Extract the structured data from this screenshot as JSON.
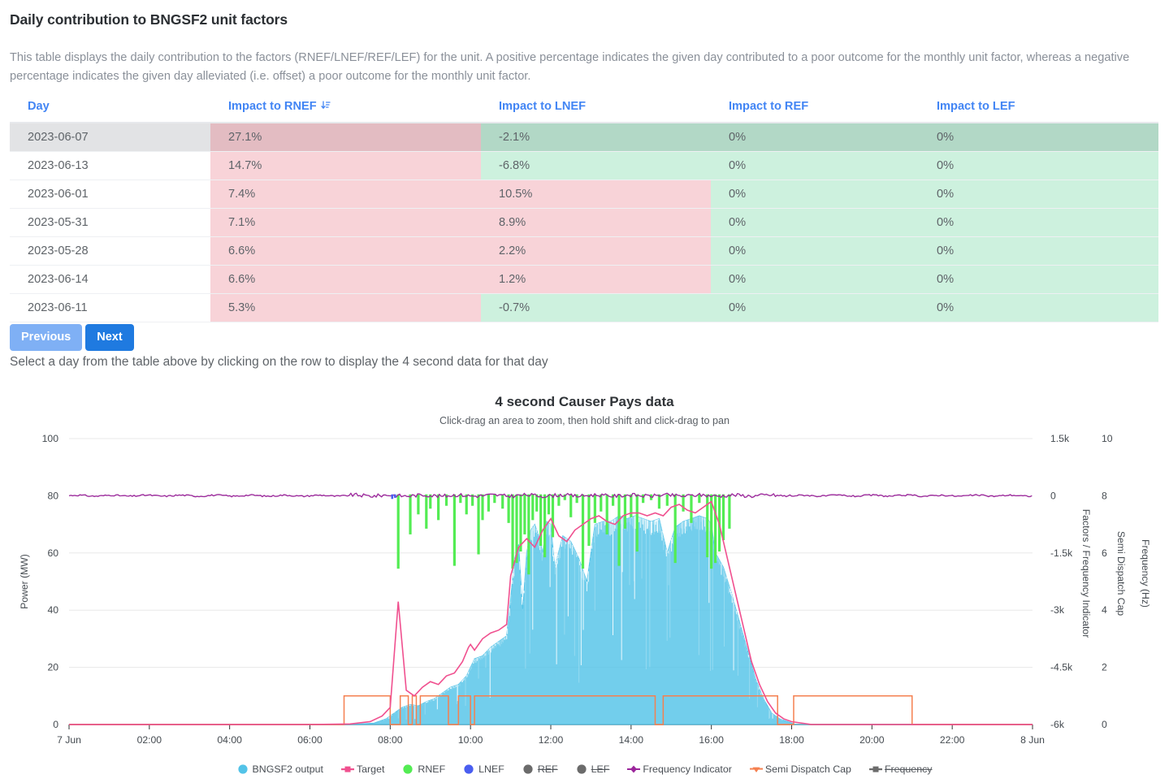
{
  "header": {
    "title": "Daily contribution to BNGSF2 unit factors",
    "description": "This table displays the daily contribution to the factors (RNEF/LNEF/REF/LEF) for the unit. A positive percentage indicates the given day contributed to a poor outcome for the monthly unit factor, whereas a negative percentage indicates the given day alleviated (i.e. offset) a poor outcome for the monthly unit factor."
  },
  "table": {
    "columns": [
      {
        "key": "day",
        "label": "Day"
      },
      {
        "key": "rnef",
        "label": "Impact to RNEF",
        "sort": "descending",
        "sort_icon": "sort-descending-icon"
      },
      {
        "key": "lnef",
        "label": "Impact to LNEF"
      },
      {
        "key": "ref",
        "label": "Impact to REF"
      },
      {
        "key": "lef",
        "label": "Impact to LEF"
      }
    ],
    "rows": [
      {
        "day": "2023-06-07",
        "rnef": "27.1%",
        "lnef": "-2.1%",
        "ref": "0%",
        "lef": "0%",
        "selected": true,
        "tint": {
          "rnef": "pink",
          "lnef": "green",
          "ref": "green",
          "lef": "green"
        }
      },
      {
        "day": "2023-06-13",
        "rnef": "14.7%",
        "lnef": "-6.8%",
        "ref": "0%",
        "lef": "0%",
        "selected": false,
        "tint": {
          "rnef": "pink",
          "lnef": "green",
          "ref": "green",
          "lef": "green"
        }
      },
      {
        "day": "2023-06-01",
        "rnef": "7.4%",
        "lnef": "10.5%",
        "ref": "0%",
        "lef": "0%",
        "selected": false,
        "tint": {
          "rnef": "pink",
          "lnef": "pink",
          "ref": "green",
          "lef": "green"
        }
      },
      {
        "day": "2023-05-31",
        "rnef": "7.1%",
        "lnef": "8.9%",
        "ref": "0%",
        "lef": "0%",
        "selected": false,
        "tint": {
          "rnef": "pink",
          "lnef": "pink",
          "ref": "green",
          "lef": "green"
        }
      },
      {
        "day": "2023-05-28",
        "rnef": "6.6%",
        "lnef": "2.2%",
        "ref": "0%",
        "lef": "0%",
        "selected": false,
        "tint": {
          "rnef": "pink",
          "lnef": "pink",
          "ref": "green",
          "lef": "green"
        }
      },
      {
        "day": "2023-06-14",
        "rnef": "6.6%",
        "lnef": "1.2%",
        "ref": "0%",
        "lef": "0%",
        "selected": false,
        "tint": {
          "rnef": "pink",
          "lnef": "pink",
          "ref": "green",
          "lef": "green"
        }
      },
      {
        "day": "2023-06-11",
        "rnef": "5.3%",
        "lnef": "-0.7%",
        "ref": "0%",
        "lef": "0%",
        "selected": false,
        "tint": {
          "rnef": "pink",
          "lnef": "green",
          "ref": "green",
          "lef": "green"
        }
      }
    ]
  },
  "pagination": {
    "previous_label": "Previous",
    "next_label": "Next"
  },
  "hint": "Select a day from the table above by clicking on the row to display the 4 second data for that day",
  "chart_data": {
    "type": "area",
    "title": "4 second Causer Pays data",
    "subtitle": "Click-drag an area to zoom, then hold shift and click-drag to pan",
    "xlabel": "",
    "x_ticks": [
      "7 Jun",
      "02:00",
      "04:00",
      "06:00",
      "08:00",
      "10:00",
      "12:00",
      "14:00",
      "16:00",
      "18:00",
      "20:00",
      "22:00",
      "8 Jun"
    ],
    "x_range_hours": [
      0,
      24
    ],
    "grid": true,
    "legend_position": "bottom",
    "axes": [
      {
        "id": "left",
        "label": "Power (MW)",
        "ticks": [
          0,
          20,
          40,
          60,
          80,
          100
        ],
        "range": [
          0,
          100
        ]
      },
      {
        "id": "right1",
        "label": "Factors / Frequency Indicator",
        "ticks": [
          "1.5k",
          "0",
          "-1.5k",
          "-3k",
          "-4.5k",
          "-6k"
        ],
        "range": [
          -6000,
          1500
        ]
      },
      {
        "id": "right2",
        "label": "Semi Dispatch Cap",
        "ticks": [
          10,
          8,
          6,
          4,
          2,
          0
        ],
        "range": [
          0,
          10
        ]
      },
      {
        "id": "right3",
        "label": "Frequency (Hz)"
      }
    ],
    "series": [
      {
        "name": "BNGSF2 output",
        "color": "#53c3e8",
        "marker": "circle",
        "visible": true,
        "axis": "left",
        "x": [
          0,
          1,
          2,
          3,
          4,
          5,
          6,
          7,
          7.6,
          7.9,
          8.1,
          8.3,
          8.5,
          8.7,
          8.9,
          9.1,
          9.3,
          9.5,
          9.7,
          9.9,
          10.0,
          10.1,
          10.3,
          10.5,
          10.7,
          10.9,
          11.0,
          11.1,
          11.2,
          11.3,
          11.4,
          11.5,
          11.6,
          11.7,
          11.8,
          11.9,
          12.0,
          12.1,
          12.3,
          12.5,
          12.7,
          12.9,
          13.1,
          13.3,
          13.5,
          13.7,
          13.9,
          14.1,
          14.3,
          14.5,
          14.7,
          14.9,
          15.1,
          15.3,
          15.5,
          15.7,
          15.9,
          16.0,
          16.1,
          16.3,
          16.5,
          16.7,
          16.9,
          17.1,
          17.3,
          17.5,
          17.7,
          17.9,
          18.1,
          18.4,
          19,
          20,
          21,
          22,
          23,
          24
        ],
        "y": [
          0,
          0,
          0,
          0,
          0,
          0,
          0,
          0,
          0.5,
          2,
          4,
          6,
          7,
          6.5,
          8,
          9,
          11,
          13,
          14,
          17,
          20,
          23,
          24,
          27,
          29,
          31,
          44,
          58,
          63,
          40,
          60,
          68,
          70,
          66,
          60,
          71,
          70,
          55,
          66,
          64,
          58,
          50,
          70,
          71,
          71,
          73,
          72,
          73,
          72,
          71,
          72,
          60,
          69,
          71,
          72,
          73,
          72,
          70,
          60,
          55,
          46,
          36,
          26,
          16,
          9,
          4,
          2,
          1,
          0,
          0,
          0,
          0,
          0,
          0,
          0,
          0
        ]
      },
      {
        "name": "Target",
        "color": "#f0508f",
        "marker": "square",
        "visible": true,
        "axis": "left",
        "x": [
          0,
          2,
          4,
          6,
          7,
          7.5,
          7.8,
          8.0,
          8.2,
          8.4,
          8.6,
          8.8,
          9.0,
          9.2,
          9.4,
          9.6,
          9.8,
          9.95,
          10.0,
          10.1,
          10.3,
          10.5,
          10.7,
          10.9,
          11.0,
          11.2,
          11.4,
          11.6,
          11.8,
          12.0,
          12.2,
          12.4,
          12.6,
          12.8,
          13.0,
          13.2,
          13.4,
          13.6,
          13.8,
          14.0,
          14.2,
          14.4,
          14.6,
          14.8,
          15.0,
          15.2,
          15.4,
          15.6,
          15.8,
          16.0,
          16.2,
          16.4,
          16.6,
          16.8,
          17.0,
          17.2,
          17.4,
          17.6,
          17.8,
          18.0,
          18.5,
          19,
          21,
          23,
          24
        ],
        "y": [
          0,
          0,
          0,
          0,
          0.2,
          1,
          3,
          6,
          43,
          12,
          10,
          13,
          15,
          14,
          17,
          18,
          22,
          27,
          28,
          26,
          30,
          32,
          33,
          35,
          52,
          62,
          65,
          62,
          68,
          72,
          66,
          64,
          68,
          70,
          72,
          73,
          71,
          70,
          73,
          74,
          74,
          73,
          74,
          73,
          76,
          77,
          75,
          74,
          76,
          78,
          70,
          58,
          46,
          34,
          22,
          14,
          8,
          4,
          2,
          1,
          0,
          0,
          0,
          0,
          0
        ]
      },
      {
        "name": "RNEF",
        "color": "#53ec53",
        "marker": "circle",
        "visible": true,
        "axis": "right1",
        "spikes_x": [
          8.2,
          8.5,
          8.7,
          8.9,
          9.0,
          9.2,
          9.4,
          9.6,
          9.75,
          9.9,
          10.05,
          10.2,
          10.3,
          10.45,
          10.6,
          10.8,
          10.95,
          11.05,
          11.15,
          11.25,
          11.35,
          11.45,
          11.55,
          11.65,
          11.75,
          11.85,
          11.95,
          12.05,
          12.2,
          12.35,
          12.5,
          12.65,
          12.8,
          12.95,
          13.1,
          13.25,
          13.4,
          13.55,
          13.7,
          13.85,
          14.0,
          14.15,
          14.3,
          14.5,
          14.7,
          14.9,
          15.1,
          15.3,
          15.5,
          15.7,
          15.9,
          16.0,
          16.1,
          16.2,
          16.3,
          16.45
        ],
        "spikes_depth": [
          26,
          14,
          7,
          12,
          5,
          9,
          4,
          25,
          3,
          7,
          4,
          21,
          9,
          6,
          3,
          5,
          10,
          26,
          24,
          20,
          14,
          28,
          9,
          6,
          18,
          22,
          7,
          15,
          4,
          2,
          8,
          3,
          26,
          18,
          10,
          6,
          14,
          4,
          25,
          12,
          8,
          20,
          3,
          2,
          5,
          4,
          24,
          6,
          10,
          3,
          22,
          26,
          24,
          20,
          16,
          12
        ]
      },
      {
        "name": "LNEF",
        "color": "#4a5ef0",
        "marker": "circle",
        "visible": true,
        "axis": "right1"
      },
      {
        "name": "REF",
        "color": "#6b6b6b",
        "marker": "circle",
        "visible": false,
        "axis": "right1"
      },
      {
        "name": "LEF",
        "color": "#6b6b6b",
        "marker": "circle",
        "visible": false,
        "axis": "right1"
      },
      {
        "name": "Frequency Indicator",
        "color": "#9b259b",
        "marker": "diamond",
        "visible": true,
        "axis": "right1",
        "baseline": 80
      },
      {
        "name": "Semi Dispatch Cap",
        "color": "#f58050",
        "marker": "triangle-down",
        "visible": true,
        "axis": "right2",
        "steps": [
          [
            6.85,
            8.0
          ],
          [
            8.25,
            8.45
          ],
          [
            8.55,
            8.65
          ],
          [
            8.75,
            9.45
          ],
          [
            9.7,
            10.0
          ],
          [
            10.1,
            14.6
          ],
          [
            14.8,
            17.65
          ],
          [
            18.05,
            21.0
          ]
        ]
      },
      {
        "name": "Frequency",
        "color": "#6b6b6b",
        "marker": "square",
        "visible": false,
        "axis": "right3"
      }
    ]
  }
}
